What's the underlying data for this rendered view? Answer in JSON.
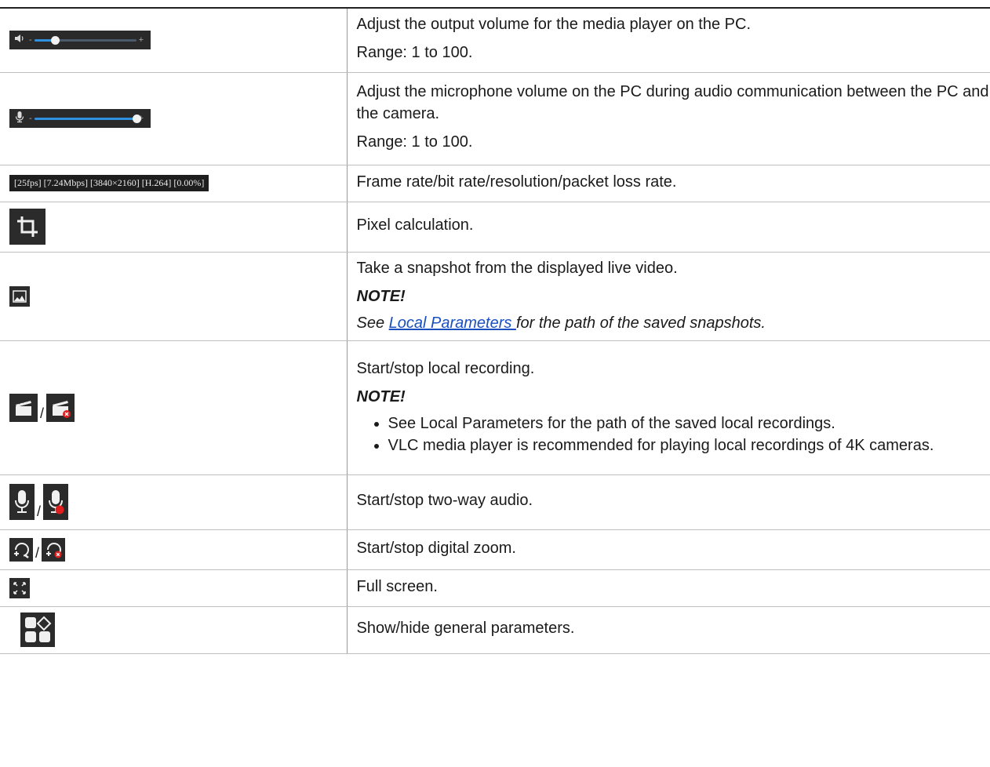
{
  "rows": [
    {
      "icon": "speaker-volume-slider",
      "slider_level_percent": 20,
      "minus": "-",
      "plus": "+",
      "lines": [
        "Adjust the output volume for the media player on the PC.",
        "Range: 1 to 100."
      ]
    },
    {
      "icon": "microphone-volume-slider",
      "slider_level_percent": 100,
      "minus": "-",
      "plus": "+",
      "lines": [
        "Adjust the microphone volume on the PC during audio communication between the PC and the camera.",
        "Range: 1 to 100."
      ]
    },
    {
      "icon": "stream-stats-bar",
      "stats_text": "[25fps] [7.24Mbps] [3840×2160] [H.264] [0.00%]",
      "lines": [
        "Frame rate/bit rate/resolution/packet loss rate."
      ]
    },
    {
      "icon": "crop-icon",
      "lines": [
        "Pixel calculation."
      ]
    },
    {
      "icon": "snapshot-icon",
      "lines": [
        "Take a snapshot from the displayed live video."
      ],
      "note_label": "NOTE!",
      "note_link": "Local Parameters ",
      "note_rest": "for the path of the saved snapshots.",
      "note_prefix": "See "
    },
    {
      "icon": "record-icon",
      "separator": "/",
      "lines": [
        "Start/stop local recording."
      ],
      "note_label": "NOTE!",
      "bullets": [
        "See Local Parameters for the path of the saved local recordings.",
        "VLC media player is recommended for playing local recordings of 4K cameras."
      ]
    },
    {
      "icon": "two-way-audio-icon",
      "separator": "/",
      "lines": [
        "Start/stop two-way audio."
      ]
    },
    {
      "icon": "digital-zoom-icon",
      "separator": "/",
      "lines": [
        "Start/stop digital zoom."
      ]
    },
    {
      "icon": "full-screen-icon",
      "lines": [
        "Full screen."
      ]
    },
    {
      "icon": "general-parameters-icon",
      "lines": [
        "Show/hide general parameters."
      ]
    }
  ],
  "colors": {
    "icon_bg": "#2b2b2b",
    "slider_fill": "#2f8fe0",
    "stop_badge": "#e02020",
    "link": "#1a4fc0"
  }
}
